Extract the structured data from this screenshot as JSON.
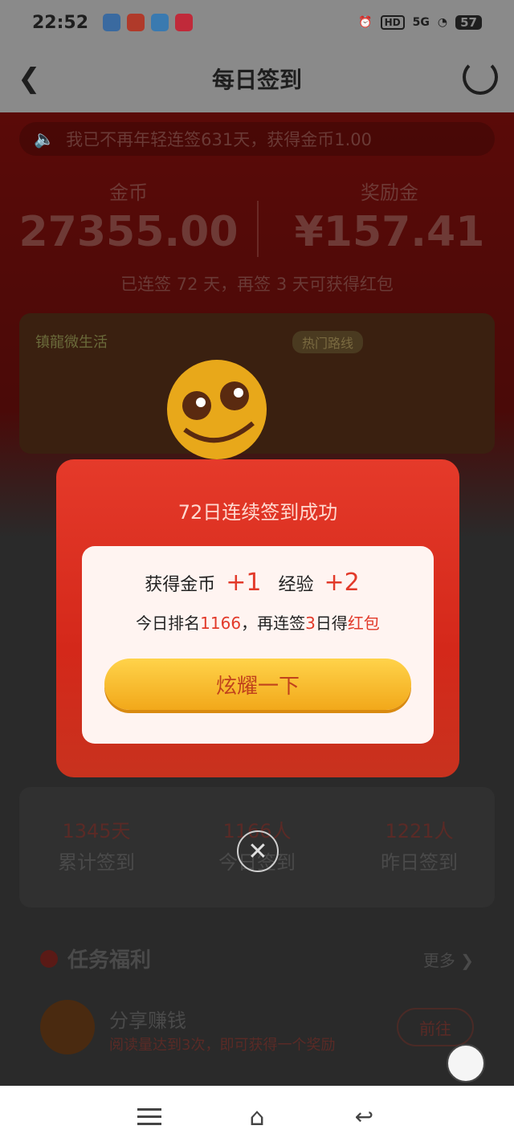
{
  "status_bar": {
    "time": "22:52",
    "network": "5G",
    "hd": "HD",
    "battery": "57"
  },
  "nav": {
    "title": "每日签到"
  },
  "notice": {
    "text": "我已不再年轻连签631天，获得金币1.00"
  },
  "balances": {
    "coins_label": "金币",
    "coins_value": "27355.00",
    "bonus_label": "奖励金",
    "bonus_value": "¥157.41"
  },
  "streak_text": "已连签 72 天，再签 3 天可获得红包",
  "banner": {
    "brand": "镇龍微生活",
    "tag": "热门路线"
  },
  "modal": {
    "title": "72日连续签到成功",
    "coin_label": "获得金币",
    "coin_plus": "+1",
    "exp_label": "经验",
    "exp_plus": "+2",
    "rank_prefix": "今日排名",
    "rank_value": "1166",
    "rank_mid": "，再连签",
    "days_value": "3",
    "rank_mid2": "日得",
    "reward_name": "红包",
    "button": "炫耀一下"
  },
  "stats": [
    {
      "value": "1345天",
      "label": "累计签到"
    },
    {
      "value": "1166人",
      "label": "今日签到"
    },
    {
      "value": "1221人",
      "label": "昨日签到"
    }
  ],
  "tasks": {
    "title": "任务福利",
    "more": "更多",
    "items": [
      {
        "name": "分享赚钱",
        "desc": "阅读量达到3次，即可获得一个奖励",
        "action": "前往"
      }
    ]
  },
  "colors": {
    "accent": "#e23a2a",
    "button": "#f2a81a",
    "modal_bg": "#d4281a"
  },
  "icons": [
    "back-icon",
    "refresh-icon",
    "speaker-icon",
    "close-icon",
    "menu-icon",
    "home-icon",
    "return-icon"
  ]
}
